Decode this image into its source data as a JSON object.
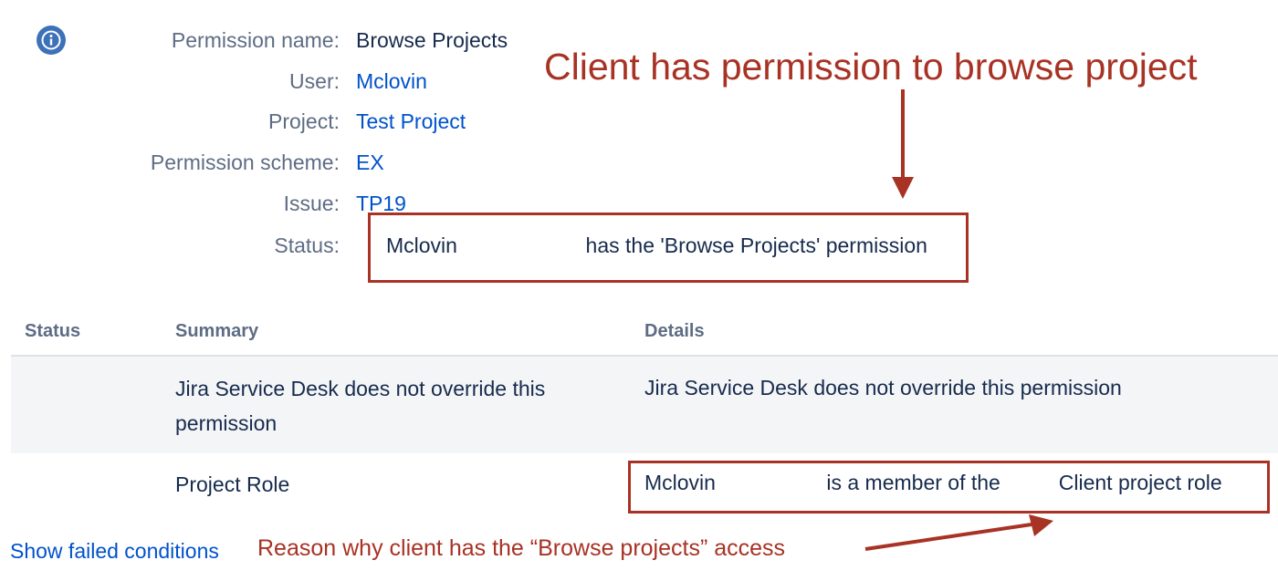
{
  "permission": {
    "rows": [
      {
        "label": "Permission name:",
        "value": "Browse Projects",
        "kind": "text"
      },
      {
        "label": "User:",
        "value": "Mclovin",
        "kind": "link"
      },
      {
        "label": "Project:",
        "value": "Test Project",
        "kind": "link"
      },
      {
        "label": "Permission scheme:",
        "value": "EX",
        "kind": "link"
      },
      {
        "label": "Issue:",
        "value": "TP19",
        "kind": "link"
      },
      {
        "label": "Status:",
        "value": "",
        "kind": "text"
      }
    ],
    "status_text": "Mclovin                      has the 'Browse Projects' permission"
  },
  "annotations": {
    "top": "Client has permission to browse project",
    "bottom": "Reason why client has the “Browse projects” access"
  },
  "table": {
    "headers": [
      "Status",
      "Summary",
      "Details"
    ],
    "rows": [
      {
        "status": "",
        "summary": "Jira Service Desk does not override this permission",
        "details": "Jira Service Desk does not override this permission"
      },
      {
        "status": "",
        "summary": "Project Role",
        "details": "Mclovin                   is a member of the          Client project role"
      }
    ]
  },
  "footer": {
    "show_failed": "Show failed conditions"
  },
  "colors": {
    "annotation": "#a83224",
    "link": "#0052cc",
    "info_icon": "#3d71b8"
  },
  "icons": {
    "info": "info-icon"
  }
}
